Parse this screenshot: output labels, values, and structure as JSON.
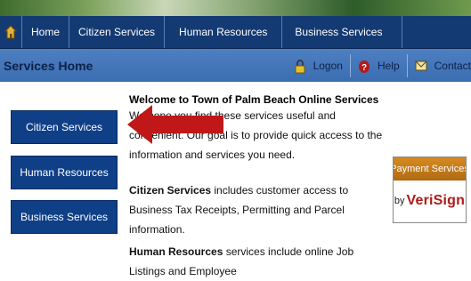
{
  "nav": {
    "home_label": "Home",
    "items": [
      "Citizen Services",
      "Human Resources",
      "Business Services"
    ]
  },
  "header": {
    "title": "Services Home",
    "utilities": [
      {
        "label": "Logon",
        "icon": "lock-icon"
      },
      {
        "label": "Help",
        "icon": "help-icon"
      },
      {
        "label": "Contact",
        "icon": "mail-icon"
      }
    ]
  },
  "sidebar": {
    "buttons": [
      "Citizen Services",
      "Human Resources",
      "Business Services"
    ]
  },
  "content": {
    "welcome": "Welcome to Town of Palm Beach Online Services",
    "intro": "We hope you find these services useful and convenient. Our goal is to provide quick access to the information and services you need.",
    "citizen_lead": "Citizen Services",
    "citizen_text": " includes customer access to Business Tax Receipts, Permitting and Parcel information.",
    "hr_lead": "Human Resources",
    "hr_text": " services include online Job Listings and Employee"
  },
  "badge": {
    "top": "Payment Services",
    "by": "by",
    "brand": "VeriSign"
  },
  "colors": {
    "nav_bg": "#143a73",
    "header_bg": "#4e7fc1",
    "button_bg": "#0f3f86",
    "arrow": "#c01818",
    "badge_orange": "#c47a1a"
  }
}
